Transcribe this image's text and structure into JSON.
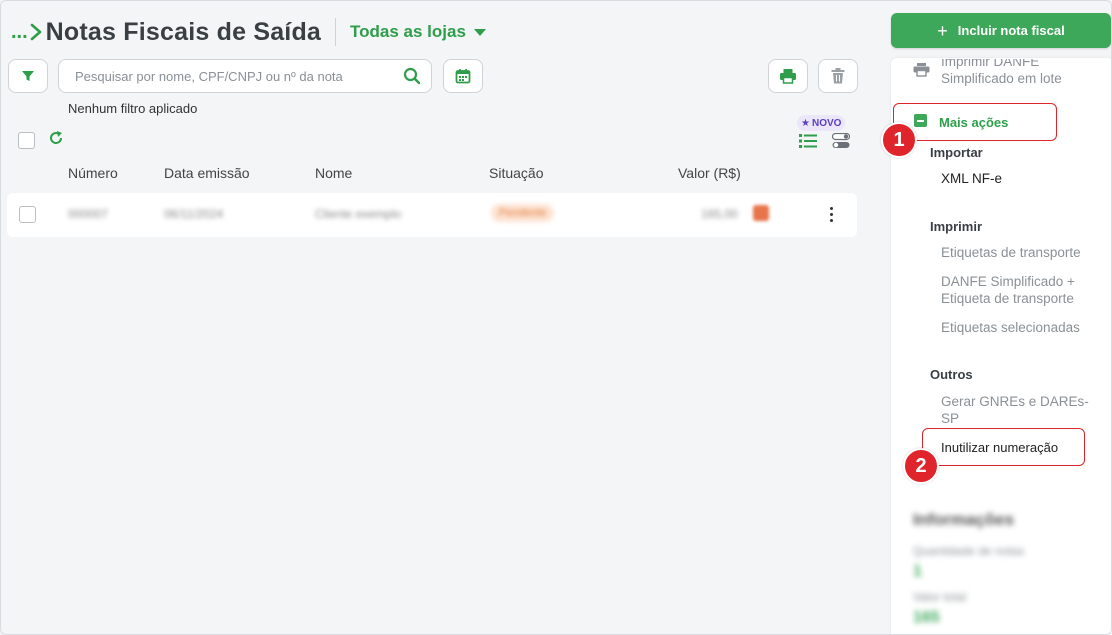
{
  "header": {
    "breadcrumb_dots": "...",
    "title": "Notas Fiscais de Saída",
    "store_select": "Todas as lojas"
  },
  "toolbar": {
    "search_placeholder": "Pesquisar por nome, CPF/CNPJ ou nº da nota",
    "filter_status": "Nenhum filtro aplicado",
    "novo_badge": "NOVO"
  },
  "table": {
    "columns": [
      "Número",
      "Data emissão",
      "Nome",
      "Situação",
      "Valor (R$)"
    ],
    "rows": [
      {
        "numero": "000007",
        "data": "06/11/2024",
        "nome": "Cliente exemplo",
        "situacao": "Pendente",
        "valor": "165,00"
      }
    ]
  },
  "sidebar": {
    "primary_button": "Incluir nota fiscal",
    "batch_print_label": "Imprimir DANFE Simplificado em lote",
    "more_actions_label": "Mais ações",
    "sections": [
      {
        "title": "Importar",
        "items": [
          "XML NF-e"
        ]
      },
      {
        "title": "Imprimir",
        "items": [
          "Etiquetas de transporte",
          "DANFE Simplificado + Etiqueta de transporte",
          "Etiquetas selecionadas"
        ]
      },
      {
        "title": "Outros",
        "items": [
          "Gerar GNREs e DAREs-SP",
          "Inutilizar numeração"
        ]
      }
    ],
    "info": {
      "title": "Informações",
      "count_label": "Quantidade de notas",
      "count_value": "1",
      "total_label": "Valor total",
      "total_value": "165"
    }
  },
  "annotations": {
    "step1": "1",
    "step2": "2"
  },
  "colors": {
    "brand_green": "#3ea85a",
    "highlight_red": "#e0242b",
    "title_grey": "#3a3f44",
    "novo_purple": "#5b3fc2"
  }
}
